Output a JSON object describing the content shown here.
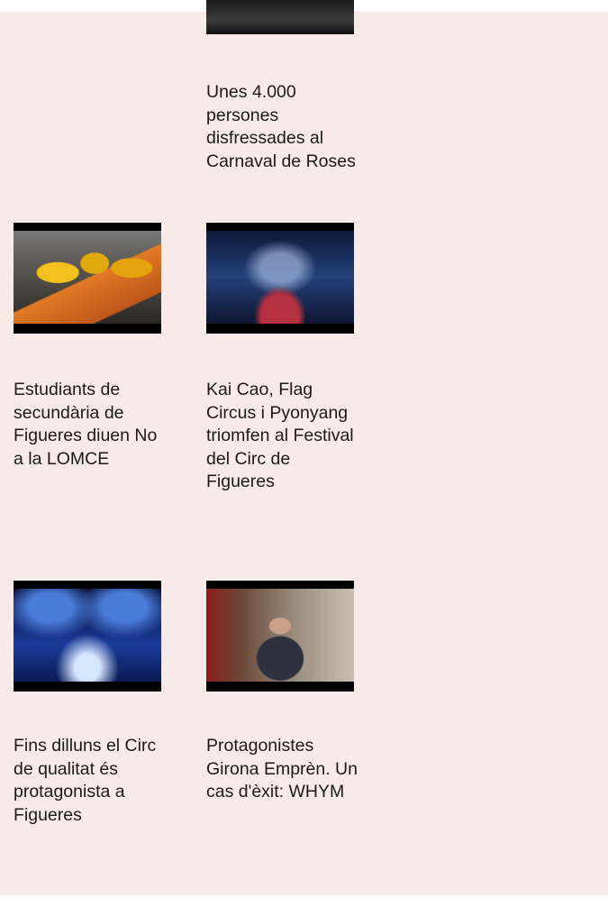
{
  "items": [
    {
      "title": "Unes 4.000 persones disfressades al Carnaval de Roses"
    },
    {
      "title": "Estudiants de secundària de Figueres diuen No a la LOMCE"
    },
    {
      "title": "Kai Cao, Flag Circus i Pyonyang triomfen al Festival del Circ de Figueres"
    },
    {
      "title": "Fins dilluns el Circ de qualitat és protagonista a Figueres"
    },
    {
      "title": "Protagonistes Girona Emprèn. Un cas d'èxit: WHYM"
    }
  ]
}
